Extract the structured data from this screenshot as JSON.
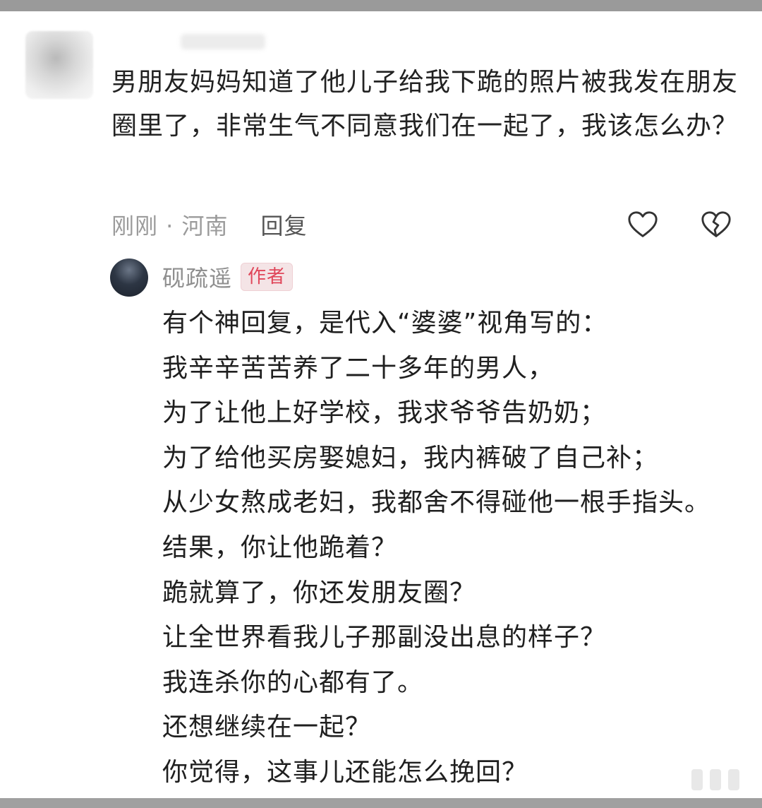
{
  "comment": {
    "text": "男朋友妈妈知道了他儿子给我下跪的照片被我发在朋友圈里了，非常生气不同意我们在一起了，我该怎么办？",
    "time_location": "刚刚 · 河南",
    "reply_label": "回复"
  },
  "icons": {
    "like": "heart-outline-icon",
    "dislike": "broken-heart-icon"
  },
  "reply": {
    "author": "砚疏遥",
    "badge": "作者",
    "lines": [
      "有个神回复，是代入“婆婆”视角写的：",
      "我辛辛苦苦养了二十多年的男人，",
      "为了让他上好学校，我求爷爷告奶奶；",
      "为了给他买房娶媳妇，我内裤破了自己补；",
      "从少女熬成老妇，我都舍不得碰他一根手指头。",
      "结果，你让他跪着？",
      "跪就算了，你还发朋友圈？",
      "让全世界看我儿子那副没出息的样子？",
      "我连杀你的心都有了。",
      "还想继续在一起？",
      "你觉得，这事儿还能怎么挽回？"
    ]
  },
  "colors": {
    "badge_text": "#e0475a",
    "badge_bg": "#f4e4e6",
    "meta_text": "#9b9b9b"
  }
}
